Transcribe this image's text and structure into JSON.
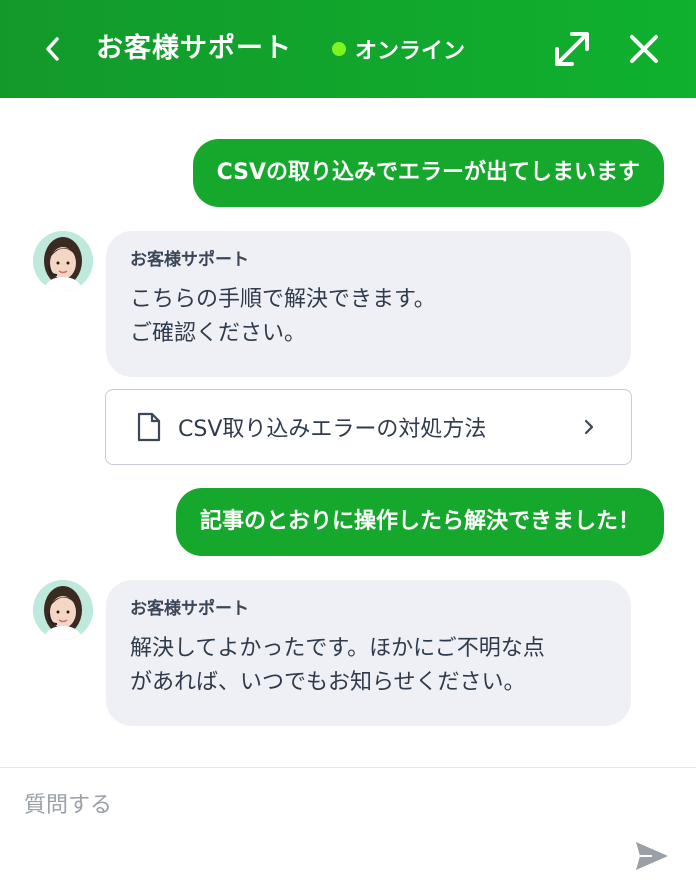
{
  "header": {
    "title": "お客様サポート",
    "status": "オンライン",
    "status_color": "#7ff520",
    "background": "#13a82c",
    "icons": {
      "back": "chevron-left-icon",
      "expand": "expand-arrows-icon",
      "close": "close-icon"
    }
  },
  "messages": [
    {
      "from": "user",
      "text": "CSVの取り込みでエラーが出てしまいます"
    },
    {
      "from": "bot",
      "name": "お客様サポート",
      "text": "こちらの手順で解決できます。\nご確認ください。"
    },
    {
      "from": "bot-attachment",
      "title": "CSV取り込みエラーの対処方法",
      "icon": "document-icon"
    },
    {
      "from": "user",
      "text": "記事のとおりに操作したら解決できました！"
    },
    {
      "from": "bot",
      "name": "お客様サポート",
      "text": "解決してよかったです。ほかにご不明な点\nがあれば、いつでもお知らせください。"
    }
  ],
  "composer": {
    "placeholder": "質問する",
    "value": "",
    "send_icon": "send-icon"
  },
  "colors": {
    "user_bubble": "#16a82c",
    "bot_bubble": "#eef0f5",
    "avatar_bg": "#bfe9dd"
  }
}
